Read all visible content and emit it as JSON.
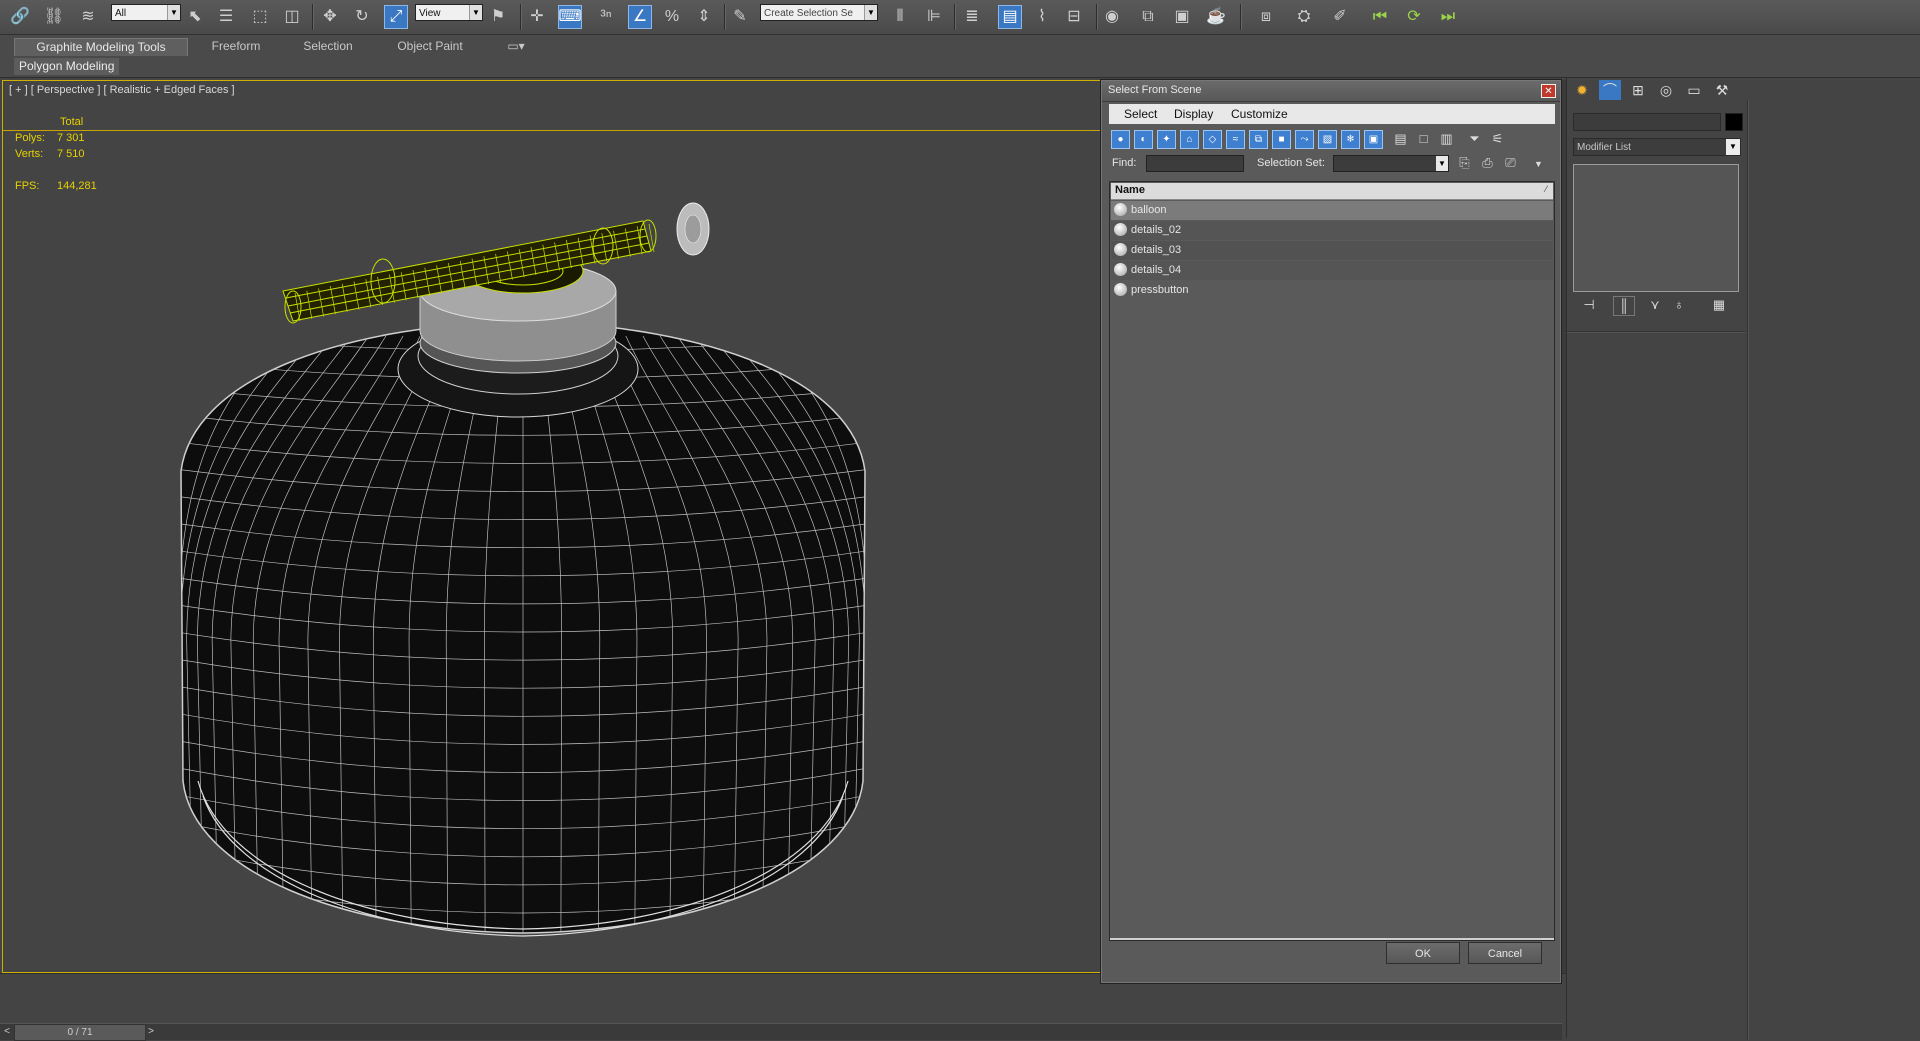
{
  "toolbar": {
    "selection_filter": "All",
    "reference_coord": "View",
    "named_selection_placeholder": "Create Selection Se"
  },
  "ribbon": {
    "tabs": [
      "Graphite Modeling Tools",
      "Freeform",
      "Selection",
      "Object Paint"
    ],
    "active_tab": "Graphite Modeling Tools",
    "panel_label": "Polygon Modeling"
  },
  "viewport": {
    "label": "[ + ] [ Perspective ] [ Realistic + Edged Faces ]",
    "stats": {
      "header": "Total",
      "polys_label": "Polys:",
      "polys_value": "7 301",
      "verts_label": "Verts:",
      "verts_value": "7 510",
      "fps_label": "FPS:",
      "fps_value": "144,281"
    }
  },
  "timeline": {
    "frame_counter": "0 / 71",
    "prev": "<",
    "next": ">"
  },
  "command_panel": {
    "modifier_list": "Modifier List"
  },
  "dialog": {
    "title": "Select From Scene",
    "close": "✕",
    "menus": [
      "Select",
      "Display",
      "Customize"
    ],
    "find_label": "Find:",
    "selection_set_label": "Selection Set:",
    "list_header": "Name",
    "objects": [
      "balloon",
      "details_02",
      "details_03",
      "details_04",
      "pressbutton"
    ],
    "selected_object": "balloon",
    "ok_label": "OK",
    "cancel_label": "Cancel"
  },
  "colors": {
    "viewport_border": "#d0b000",
    "stats_text": "#e6d200",
    "selected_wire": "#c8e000",
    "dialog_icon_blue": "#3f7fcf"
  }
}
